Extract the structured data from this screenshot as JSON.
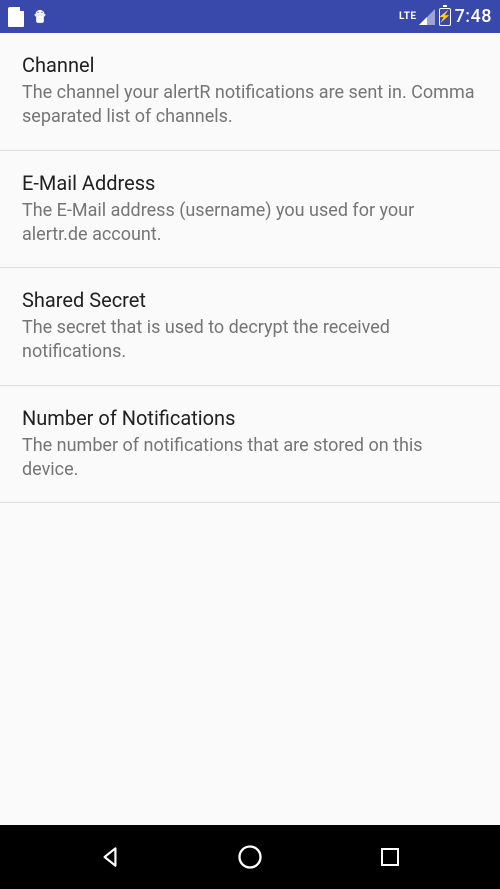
{
  "statusbar": {
    "lte": "LTE",
    "time": "7:48"
  },
  "settings": [
    {
      "title": "Channel",
      "desc": "The channel your alertR notifications are sent in. Comma separated list of channels."
    },
    {
      "title": "E-Mail Address",
      "desc": "The E-Mail address (username) you used for your alertr.de account."
    },
    {
      "title": "Shared Secret",
      "desc": "The secret that is used to decrypt the received notifications."
    },
    {
      "title": "Number of Notifications",
      "desc": "The number of notifications that are stored on this device."
    }
  ]
}
